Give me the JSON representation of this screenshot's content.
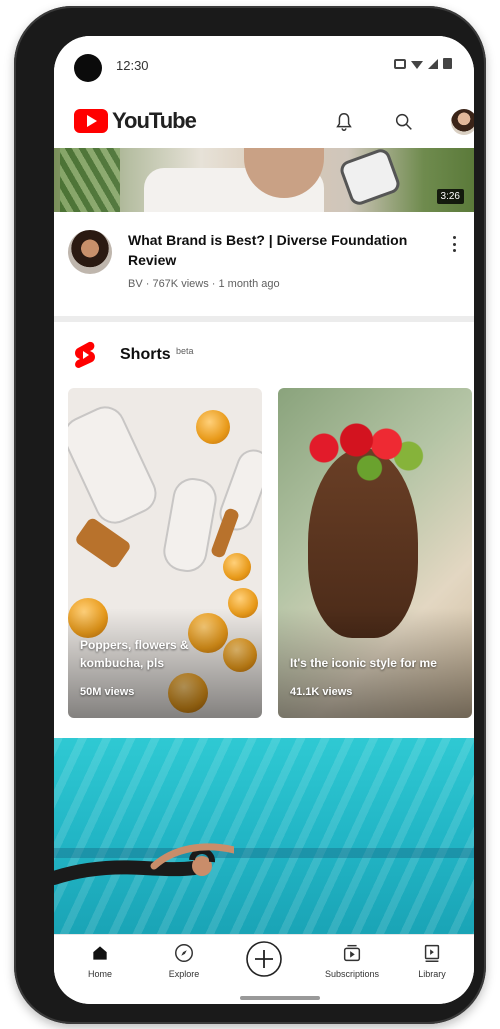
{
  "status_bar": {
    "time": "12:30"
  },
  "header": {
    "logo_text": "YouTube",
    "brand_color": "#ff0000",
    "icons": [
      "bell-icon",
      "search-icon",
      "account-avatar"
    ]
  },
  "video": {
    "duration": "3:26",
    "title": "What Brand is Best? | Diverse Foundation Review",
    "meta": "BV · 767K views · 1 month ago"
  },
  "shorts": {
    "label": "Shorts",
    "badge": "beta",
    "items": [
      {
        "caption": "Poppers, flowers & kombucha, pls",
        "views": "50M views"
      },
      {
        "caption": "It's the iconic style for me",
        "views": "41.1K views"
      }
    ]
  },
  "bottom_nav": {
    "items": [
      {
        "label": "Home",
        "icon": "home-icon"
      },
      {
        "label": "Explore",
        "icon": "compass-icon"
      },
      {
        "label": "",
        "icon": "create-icon"
      },
      {
        "label": "Subscriptions",
        "icon": "subscriptions-icon"
      },
      {
        "label": "Library",
        "icon": "library-icon"
      }
    ]
  }
}
